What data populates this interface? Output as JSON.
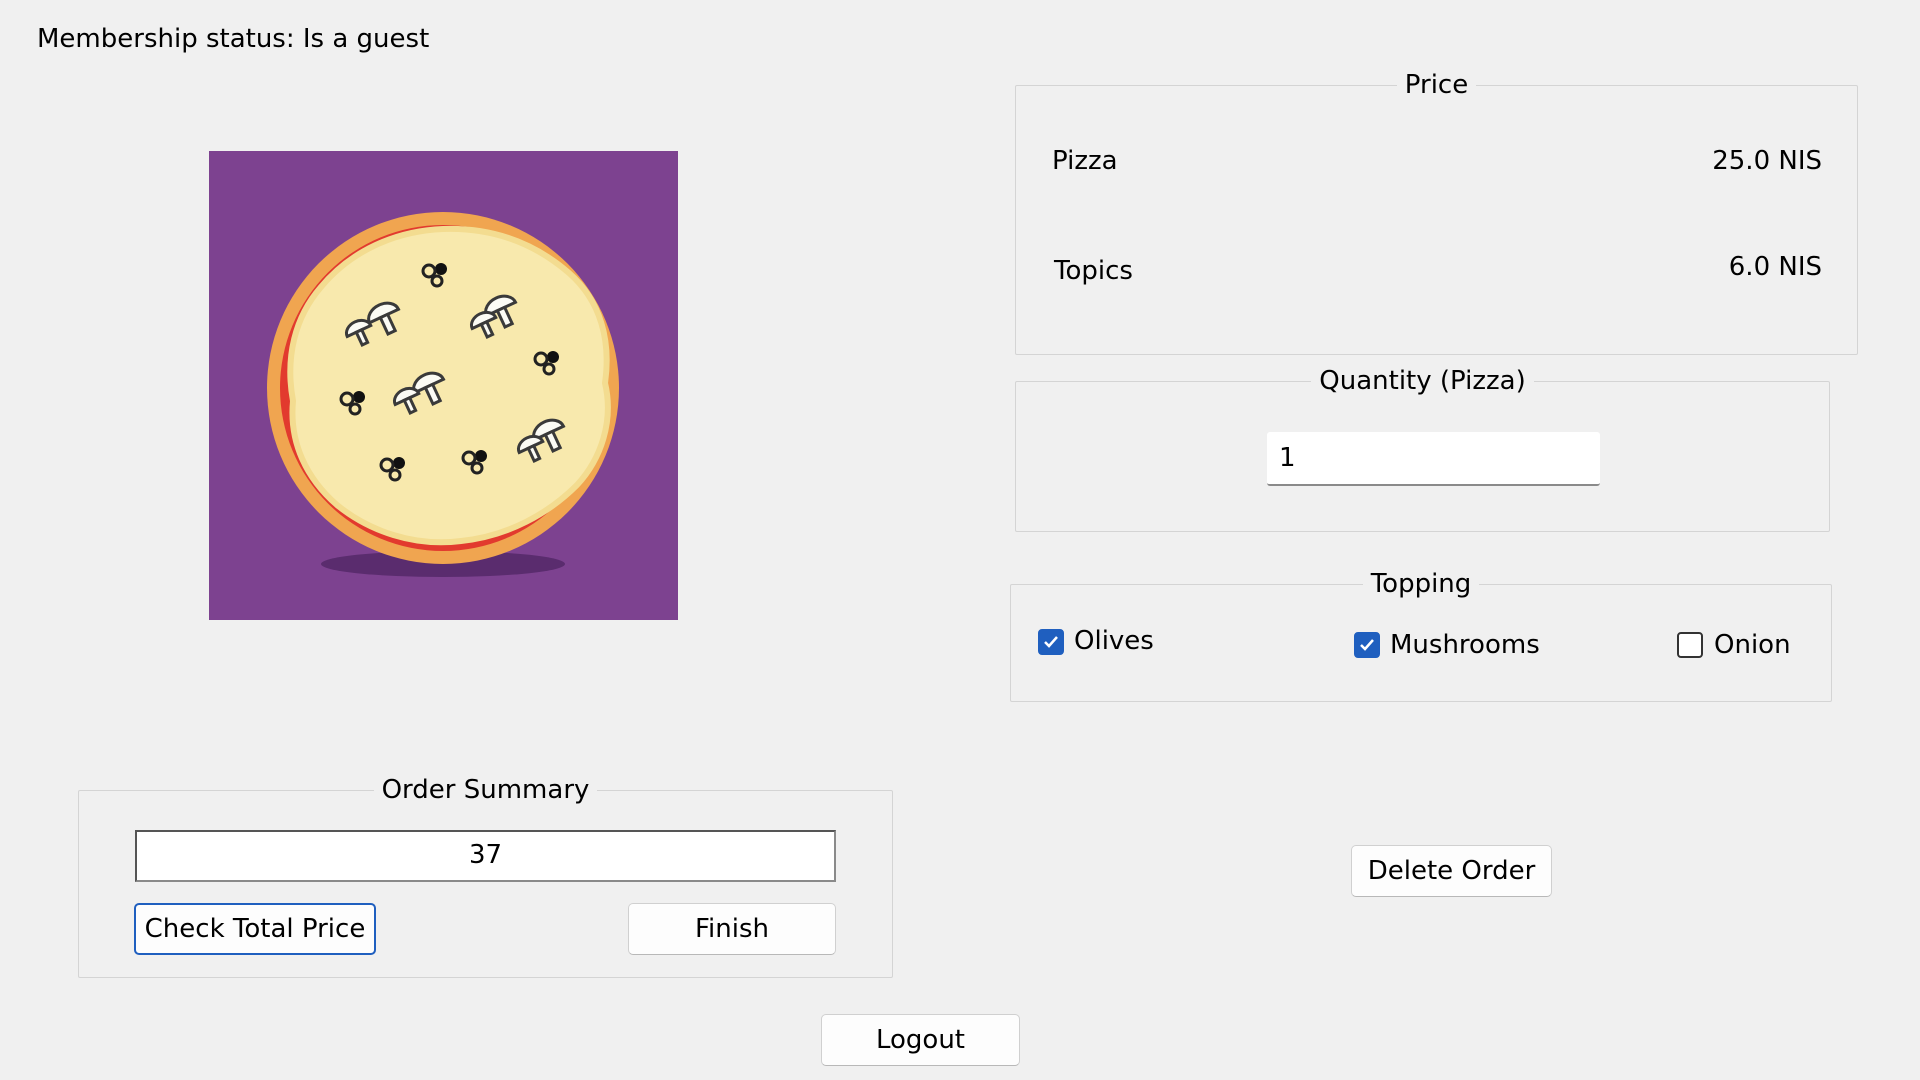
{
  "membership": {
    "status_text": "Membership status: Is a guest"
  },
  "pizza_image": {
    "background_color": "#7d4290"
  },
  "price": {
    "legend": "Price",
    "rows": [
      {
        "label": "Pizza",
        "value": "25.0 NIS"
      },
      {
        "label": "Topics",
        "value": "6.0 NIS"
      }
    ]
  },
  "quantity": {
    "legend": "Quantity (Pizza)",
    "value": "1"
  },
  "topping": {
    "legend": "Topping",
    "options": [
      {
        "label": "Olives",
        "checked": true
      },
      {
        "label": "Mushrooms",
        "checked": true
      },
      {
        "label": "Onion",
        "checked": false
      }
    ]
  },
  "order_summary": {
    "legend": "Order Summary",
    "total": "37",
    "check_button": "Check Total Price",
    "finish_button": "Finish"
  },
  "delete_button": "Delete Order",
  "logout_button": "Logout",
  "colors": {
    "accent": "#1f5fbf",
    "background": "#f0f0f0"
  }
}
